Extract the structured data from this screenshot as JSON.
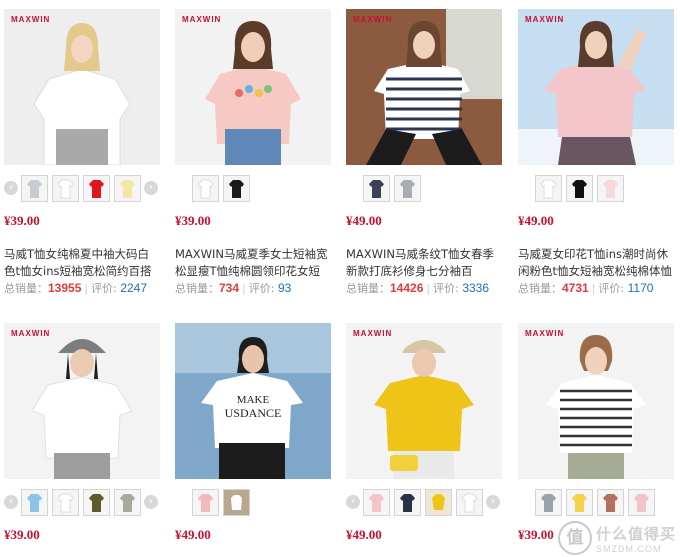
{
  "colors": {
    "price": "#c8102e",
    "sales": "#e4393c",
    "reviews": "#1c6fc0",
    "brand": "#c8102e"
  },
  "products": [
    {
      "brand_logo": "MAXWIN",
      "price": "¥39.00",
      "title_line1": "马威T恤女纯棉夏中袖大码白",
      "title_line2": "色t恤女ins短袖宽松简约百搭",
      "sales_label": "总销量：",
      "sales": "13955",
      "reviews_label": "评价:",
      "reviews": "2247",
      "thumb_colors": [
        "#c7ccd3",
        "#ffffff",
        "#e0161f",
        "#f3e7a6"
      ],
      "has_arrows": true
    },
    {
      "brand_logo": "MAXWIN",
      "price": "¥39.00",
      "title_line1": "MAXWIN马威夏季女士短袖宽",
      "title_line2": "松显瘦T恤纯棉圆领印花女短",
      "sales_label": "总销量：",
      "sales": "734",
      "reviews_label": "评价:",
      "reviews": "93",
      "thumb_colors": [
        "#ffffff",
        "#1a1a1a"
      ],
      "has_arrows": false
    },
    {
      "brand_logo": "MAXWIN",
      "price": "¥49.00",
      "title_line1": "MAXWIN马威条纹T恤女春季",
      "title_line2": "新款打底衫修身七分袖百",
      "sales_label": "总销量：",
      "sales": "14426",
      "reviews_label": "评价:",
      "reviews": "3336",
      "thumb_colors": [
        "#3b4258",
        "#a9adb3"
      ],
      "has_arrows": false
    },
    {
      "brand_logo": "MAXWIN",
      "price": "¥49.00",
      "title_line1": "马威夏女印花T恤ins潮时尚休",
      "title_line2": "闲粉色t恤女短袖宽松纯棉体恤",
      "sales_label": "总销量：",
      "sales": "4731",
      "reviews_label": "评价:",
      "reviews": "1170",
      "thumb_colors": [
        "#ffffff",
        "#111111",
        "#f7d9dc"
      ],
      "has_arrows": false
    },
    {
      "brand_logo": "MAXWIN",
      "price": "¥39.00",
      "thumb_colors": [
        "#8ec3e8",
        "#ffffff",
        "#5f5a2c",
        "#a7ab9b"
      ],
      "has_arrows": true
    },
    {
      "brand_logo": "",
      "price": "¥49.00",
      "photo_text_line1": "MAKE",
      "photo_text_line2": "USDANCE",
      "thumb_colors": [
        "#f3b9bd",
        "#b9a890"
      ],
      "has_arrows": false
    },
    {
      "brand_logo": "MAXWIN",
      "price": "¥49.00",
      "thumb_colors": [
        "#f6c4c8",
        "#2a3148",
        "#efc419",
        "#ffffff"
      ],
      "has_arrows": true
    },
    {
      "brand_logo": "MAXWIN",
      "price": "¥39.00",
      "thumb_colors": [
        "#9aa4ad",
        "#f4d34a",
        "#b3705d",
        "#f4c2c9"
      ],
      "has_arrows": false
    }
  ],
  "watermark": {
    "glyph": "值",
    "cn": "什么值得买",
    "en": "SMZDM.COM"
  },
  "icons": {
    "left_arrow": "‹",
    "right_arrow": "›"
  }
}
